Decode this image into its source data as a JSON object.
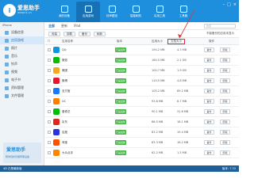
{
  "header": {
    "logo_glyph": "i",
    "brand": "爱思助手",
    "url": "www.i4.cn",
    "nav": [
      {
        "label": "我的设备",
        "active": false
      },
      {
        "label": "应用游戏",
        "active": true
      },
      {
        "label": "铃声壁纸",
        "active": false
      },
      {
        "label": "智能刷机",
        "active": false
      },
      {
        "label": "实用工具",
        "active": false
      },
      {
        "label": "工具箱",
        "active": false
      }
    ]
  },
  "sidebar": {
    "device_label": "iPhone",
    "items": [
      {
        "label": "设备信息"
      },
      {
        "label": "应用游戏"
      },
      {
        "label": "照片"
      },
      {
        "label": "音乐"
      },
      {
        "label": "铃声"
      },
      {
        "label": "视频"
      },
      {
        "label": "电子书"
      },
      {
        "label": "资料管理"
      },
      {
        "label": "文件管理"
      }
    ],
    "promo_logo": "爱思助手",
    "promo_text": "帮你轻松管理苹果设备"
  },
  "main": {
    "tabs": [
      "全部",
      "更新",
      "iPad"
    ],
    "search_placeholder": "搜索",
    "toolbar": [
      "安装",
      "卸载",
      "备份",
      "刷新"
    ],
    "filter_label": "不能备份的应用未显示",
    "headers": {
      "name": "应用名称",
      "version": "版本",
      "size": "应用大小",
      "data": "文档大小",
      "ops": "操作"
    },
    "rows": [
      {
        "name": "QQ",
        "size": "194.2 MB",
        "data": "4.3 MB"
      },
      {
        "name": "微信",
        "size": "160.5 MB",
        "data": "2.1 GB"
      },
      {
        "name": "美团",
        "size": "100.7 MB",
        "data": "1.9 GB"
      },
      {
        "name": "微博",
        "size": "110.5 MB",
        "data": "4.8 MB"
      },
      {
        "name": "支付宝",
        "size": "105.2 MB",
        "data": "89.2 MB"
      },
      {
        "name": "UC",
        "size": "93.8 MB",
        "data": "8.7 MB"
      },
      {
        "name": "爱奇艺",
        "size": "90.1 MB",
        "data": "31.6 MB"
      },
      {
        "name": "京东",
        "size": "86.5 MB",
        "data": "18.1 MB"
      },
      {
        "name": "百度",
        "size": "83.2 MB",
        "data": "19.4 MB"
      },
      {
        "name": "淘宝",
        "size": "63.3 MB",
        "data": "16.2 MB"
      },
      {
        "name": "大众点评",
        "size": "62.2 MB",
        "data": "1.5 MB"
      }
    ],
    "row_badge": "已是最新",
    "row_actions": [
      "备份",
      "卸载"
    ]
  },
  "status": {
    "left": "4D 已是最新版",
    "right": "版本: 7.33"
  },
  "colors": {
    "header": "#1e8fdc",
    "sidebar": "#eef3f8",
    "badge": "#45b545",
    "highlight": "#e23333"
  },
  "icons": {
    "row_icon_colors": [
      "#1296db",
      "#09bb07",
      "#f5a623",
      "#e6162d",
      "#1677ff",
      "#ff7e00",
      "#00be06",
      "#e1251b",
      "#2932e1",
      "#ff5000",
      "#ff8400"
    ]
  }
}
